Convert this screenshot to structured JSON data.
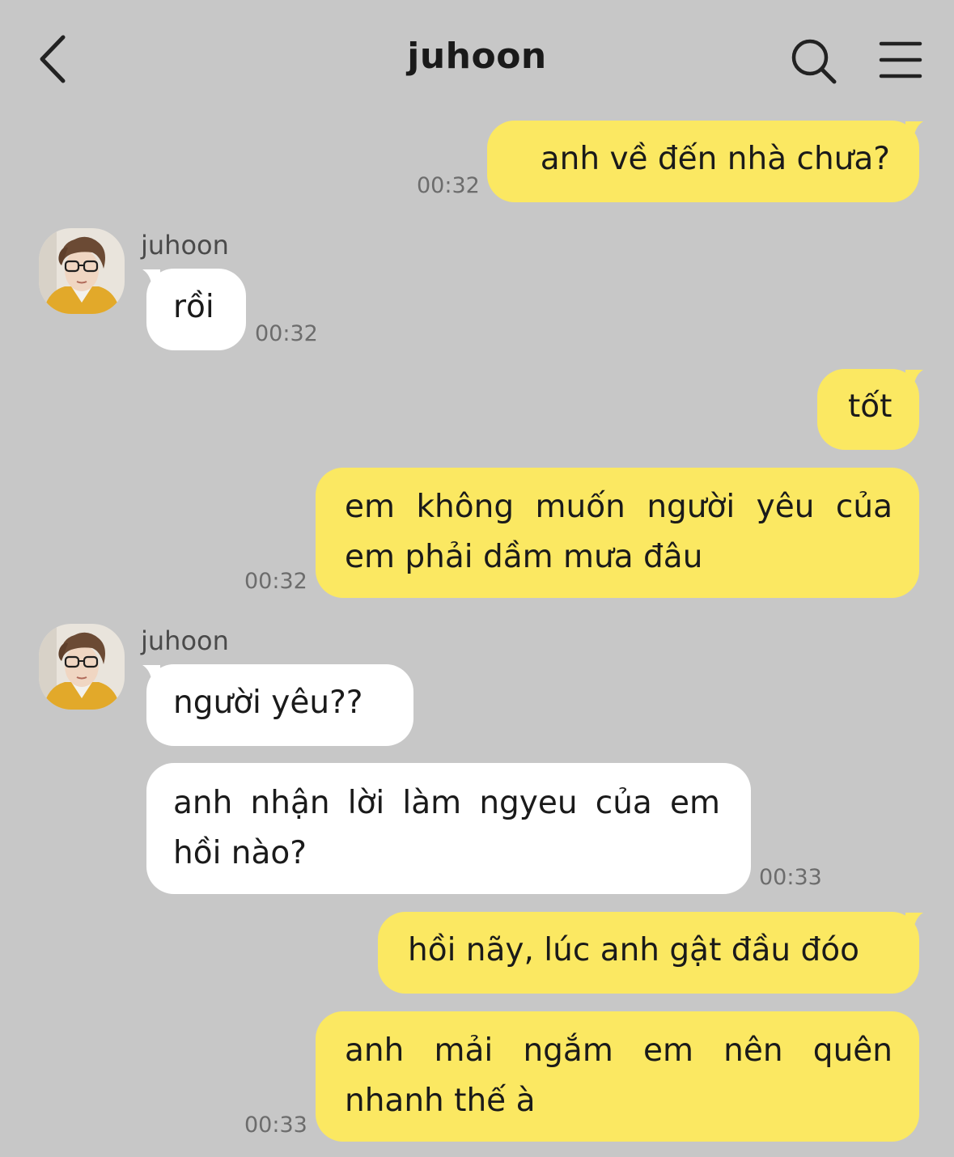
{
  "header": {
    "title": "juhoon",
    "back_icon": "chevron-left-icon",
    "search_icon": "search-icon",
    "menu_icon": "hamburger-menu-icon"
  },
  "colors": {
    "background": "#c7c7c7",
    "my_bubble": "#fbe862",
    "their_bubble": "#ffffff"
  },
  "messages": [
    {
      "from": "me",
      "text": "anh về đến nhà chưa?",
      "time": "00:32"
    },
    {
      "from": "juhoon",
      "sender": "juhoon",
      "text": "rồi",
      "time": "00:32"
    },
    {
      "from": "me",
      "text": "tốt"
    },
    {
      "from": "me",
      "text": "em không muốn người yêu của em phải dầm mưa đâu",
      "time": "00:32"
    },
    {
      "from": "juhoon",
      "sender": "juhoon",
      "text": "người yêu??"
    },
    {
      "from": "juhoon",
      "text": "anh nhận lời làm ngyeu của em hồi nào?",
      "time": "00:33"
    },
    {
      "from": "me",
      "text": "hồi nãy, lúc anh gật đầu đóo"
    },
    {
      "from": "me",
      "text": "anh mải ngắm em nên quên nhanh thế à",
      "time": "00:33"
    }
  ]
}
